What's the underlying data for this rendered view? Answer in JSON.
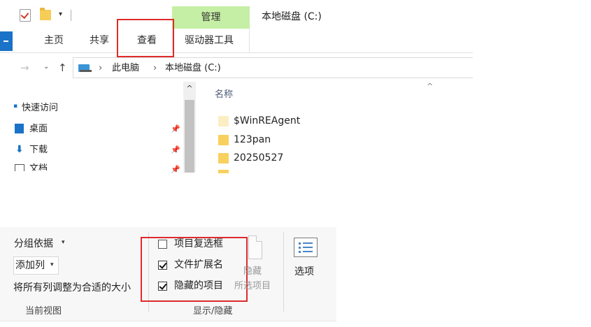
{
  "title_bar": {
    "quick_access_dropdown": "▾",
    "manage_tab": "管理",
    "window_title": "本地磁盘 (C:)"
  },
  "ribbon_tabs": {
    "home": "主页",
    "share": "共享",
    "view": "查看",
    "drive_tools": "驱动器工具"
  },
  "address_bar": {
    "forward": "→",
    "recent": "⌄",
    "up": "↑",
    "separator": "›",
    "path": [
      "此电脑",
      "本地磁盘 (C:)"
    ]
  },
  "nav_pane": {
    "quick_access": "快速访问",
    "items": [
      {
        "label": "桌面",
        "icon": "desktop-icon"
      },
      {
        "label": "下载",
        "icon": "download-icon"
      },
      {
        "label": "文档",
        "icon": "documents-icon"
      }
    ],
    "pin_glyph": "📌",
    "scroll_up": "^"
  },
  "file_list": {
    "column_name": "名称",
    "sort_caret": "^",
    "files": [
      {
        "name": "$WinREAgent",
        "hidden": true
      },
      {
        "name": "123pan",
        "hidden": false
      },
      {
        "name": "20250527",
        "hidden": false
      }
    ]
  },
  "view_ribbon": {
    "current_view": {
      "group_by": "分组依据",
      "add_column": "添加列",
      "fit_columns": "将所有列调整为合适的大小",
      "caret": "▾",
      "group_label": "当前视图"
    },
    "show_hide": {
      "checkboxes": [
        {
          "label": "项目复选框",
          "checked": false
        },
        {
          "label": "文件扩展名",
          "checked": true
        },
        {
          "label": "隐藏的项目",
          "checked": true
        }
      ],
      "hide_selected": "隐藏",
      "hide_selected_sub": "所选项目",
      "group_label": "显示/隐藏"
    },
    "options": {
      "label": "选项"
    }
  },
  "colors": {
    "manage_tab_bg": "#c5efa4",
    "highlight_red": "#e02b2b",
    "accent_blue": "#1a73c8",
    "folder_yellow": "#f7d05e"
  }
}
